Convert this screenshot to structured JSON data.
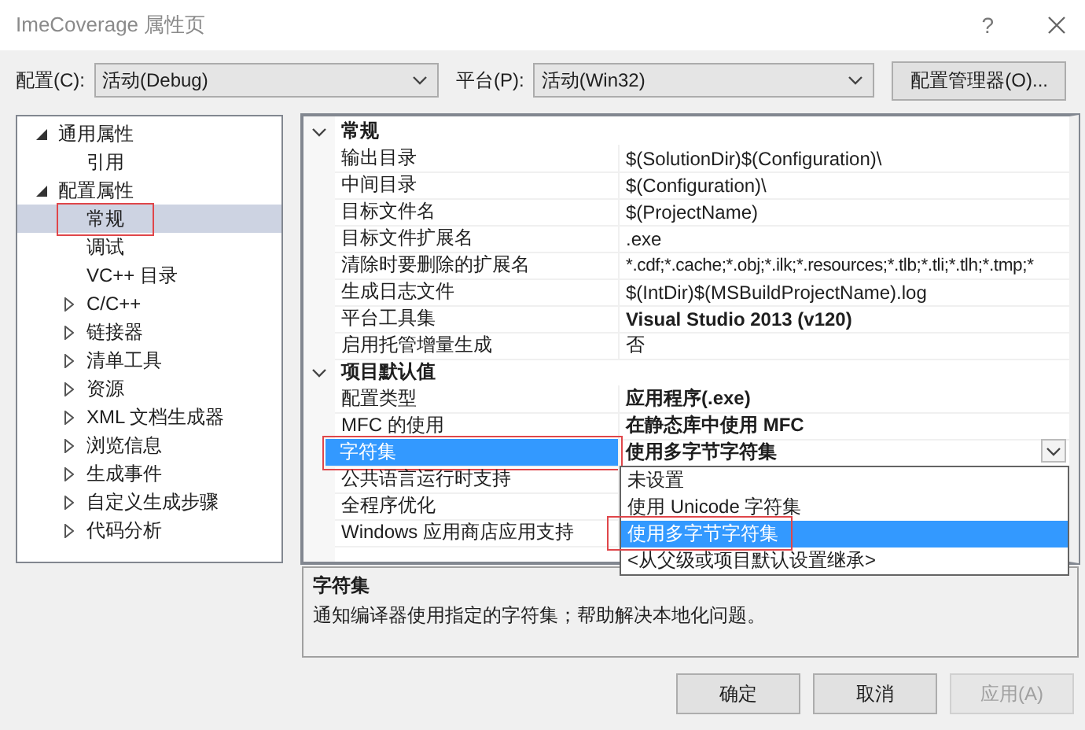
{
  "window": {
    "title": "ImeCoverage 属性页",
    "help": "?"
  },
  "toolbar": {
    "configuration": {
      "label": "配置(C):",
      "value": "活动(Debug)"
    },
    "platform": {
      "label": "平台(P):",
      "value": "活动(Win32)"
    },
    "manager_button": "配置管理器(O)..."
  },
  "tree": [
    {
      "label": "通用属性",
      "expanded": true,
      "selected": false,
      "annotated": false,
      "children": [
        {
          "label": "引用",
          "selected": false,
          "annotated": false
        }
      ]
    },
    {
      "label": "配置属性",
      "expanded": true,
      "selected": false,
      "annotated": false,
      "children": [
        {
          "label": "常规",
          "selected": true,
          "annotated": true
        },
        {
          "label": "调试",
          "selected": false,
          "annotated": false
        },
        {
          "label": "VC++ 目录",
          "selected": false,
          "annotated": false
        },
        {
          "label": "C/C++",
          "expanded": false,
          "selected": false,
          "annotated": false
        },
        {
          "label": "链接器",
          "expanded": false,
          "selected": false,
          "annotated": false
        },
        {
          "label": "清单工具",
          "expanded": false,
          "selected": false,
          "annotated": false
        },
        {
          "label": "资源",
          "expanded": false,
          "selected": false,
          "annotated": false
        },
        {
          "label": "XML 文档生成器",
          "expanded": false,
          "selected": false,
          "annotated": false
        },
        {
          "label": "浏览信息",
          "expanded": false,
          "selected": false,
          "annotated": false
        },
        {
          "label": "生成事件",
          "expanded": false,
          "selected": false,
          "annotated": false
        },
        {
          "label": "自定义生成步骤",
          "expanded": false,
          "selected": false,
          "annotated": false
        },
        {
          "label": "代码分析",
          "expanded": false,
          "selected": false,
          "annotated": false
        }
      ]
    }
  ],
  "property_grid": {
    "sections": [
      {
        "title": "常规",
        "expanded": true,
        "rows": [
          {
            "name": "输出目录",
            "value": "$(SolutionDir)$(Configuration)\\",
            "bold": false,
            "selected": false,
            "annotated": false
          },
          {
            "name": "中间目录",
            "value": "$(Configuration)\\",
            "bold": false,
            "selected": false,
            "annotated": false
          },
          {
            "name": "目标文件名",
            "value": "$(ProjectName)",
            "bold": false,
            "selected": false,
            "annotated": false
          },
          {
            "name": "目标文件扩展名",
            "value": ".exe",
            "bold": false,
            "selected": false,
            "annotated": false
          },
          {
            "name": "清除时要删除的扩展名",
            "value": "*.cdf;*.cache;*.obj;*.ilk;*.resources;*.tlb;*.tli;*.tlh;*.tmp;*",
            "bold": false,
            "selected": false,
            "annotated": false
          },
          {
            "name": "生成日志文件",
            "value": "$(IntDir)$(MSBuildProjectName).log",
            "bold": false,
            "selected": false,
            "annotated": false
          },
          {
            "name": "平台工具集",
            "value": "Visual Studio 2013 (v120)",
            "bold": true,
            "selected": false,
            "annotated": false
          },
          {
            "name": "启用托管增量生成",
            "value": "否",
            "bold": false,
            "selected": false,
            "annotated": false
          }
        ]
      },
      {
        "title": "项目默认值",
        "expanded": true,
        "rows": [
          {
            "name": "配置类型",
            "value": "应用程序(.exe)",
            "bold": true,
            "selected": false,
            "annotated": false
          },
          {
            "name": "MFC 的使用",
            "value": "在静态库中使用 MFC",
            "bold": true,
            "selected": false,
            "annotated": false
          },
          {
            "name": "字符集",
            "value": "使用多字节字符集",
            "bold": true,
            "selected": true,
            "annotated": true
          },
          {
            "name": "公共语言运行时支持",
            "selected": false,
            "annotated": false
          },
          {
            "name": "全程序优化",
            "selected": false,
            "annotated": false
          },
          {
            "name": "Windows 应用商店应用支持",
            "selected": false,
            "annotated": false
          }
        ]
      }
    ],
    "dropdown": {
      "options": [
        {
          "label": "未设置",
          "selected": false,
          "annotated": false
        },
        {
          "label": "使用 Unicode 字符集",
          "selected": false,
          "annotated": false
        },
        {
          "label": "使用多字节字符集",
          "selected": true,
          "annotated": true
        },
        {
          "label": "<从父级或项目默认设置继承>",
          "selected": false,
          "annotated": false
        }
      ]
    }
  },
  "description": {
    "title": "字符集",
    "text": "通知编译器使用指定的字符集；帮助解决本地化问题。"
  },
  "buttons": [
    {
      "label": "确定",
      "disabled": false
    },
    {
      "label": "取消",
      "disabled": false
    },
    {
      "label": "应用(A)",
      "disabled": true
    }
  ]
}
